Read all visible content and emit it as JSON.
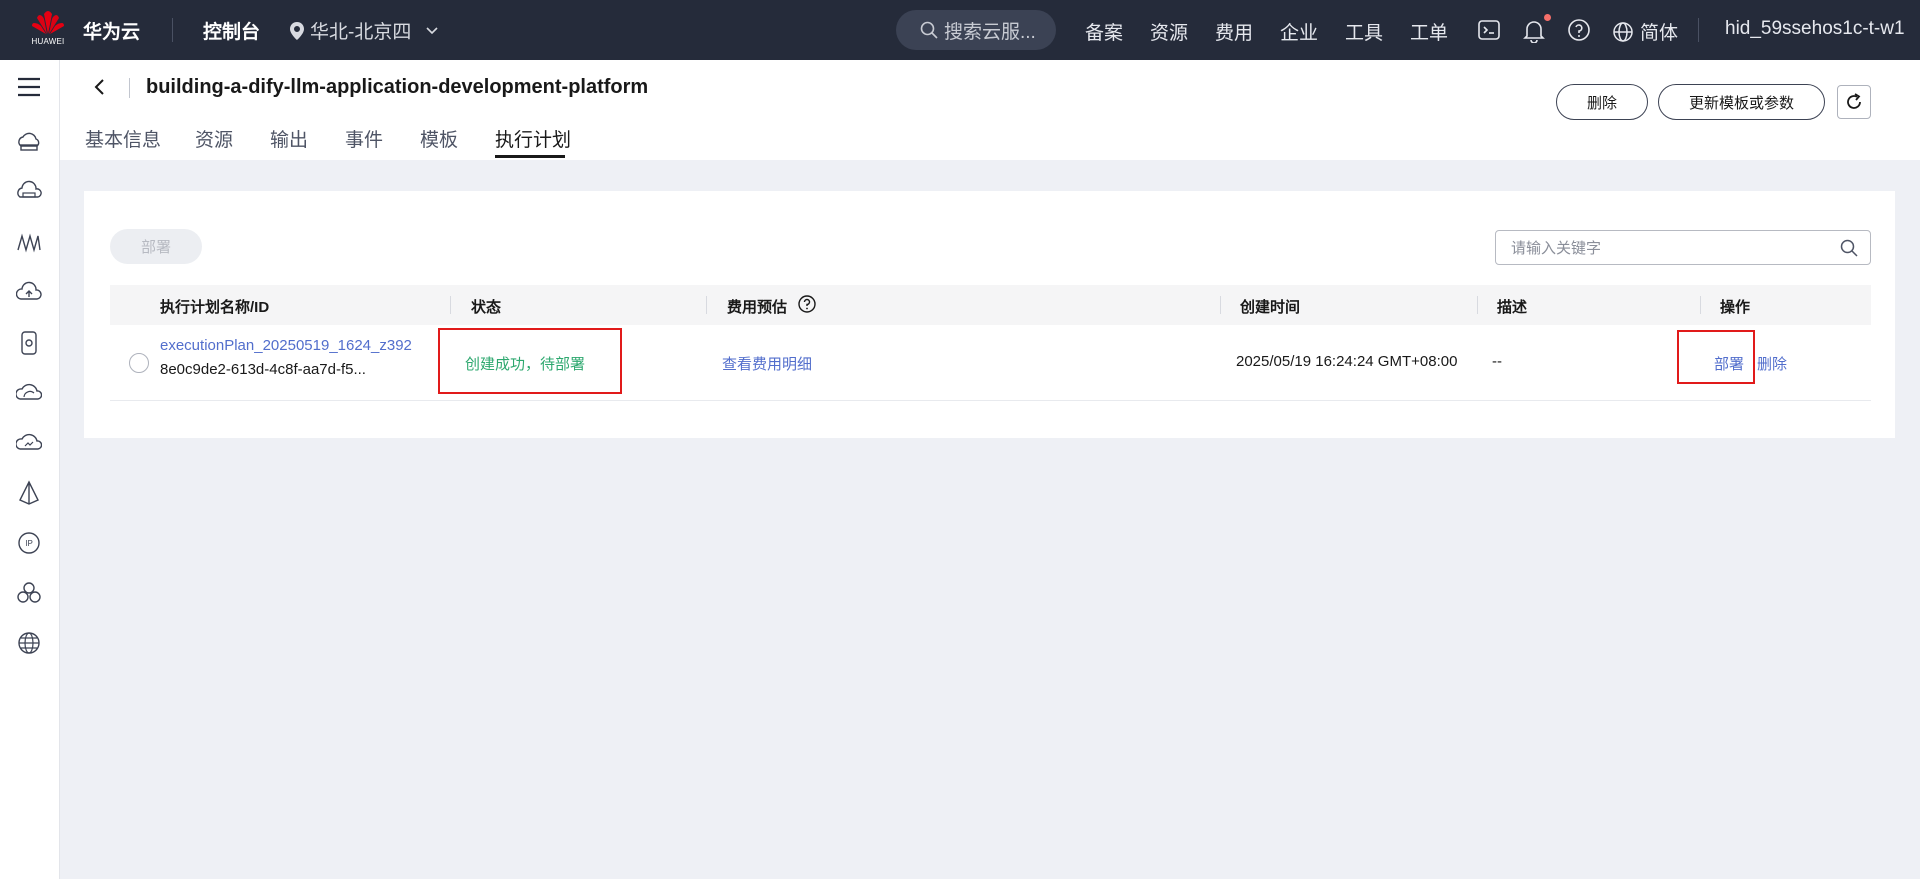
{
  "topbar": {
    "logo_text": "HUAWEI",
    "brand": "华为云",
    "console": "控制台",
    "region": "华北-北京四",
    "search_placeholder": "搜索云服...",
    "nav": [
      "备案",
      "资源",
      "费用",
      "企业",
      "工具",
      "工单"
    ],
    "language": "简体",
    "user": "hid_59ssehos1c-t-w1"
  },
  "header": {
    "title": "building-a-dify-llm-application-development-platform",
    "tabs": [
      "基本信息",
      "资源",
      "输出",
      "事件",
      "模板",
      "执行计划"
    ],
    "active_tab": "执行计划",
    "delete_label": "删除",
    "update_label": "更新模板或参数"
  },
  "toolbar": {
    "deploy_label": "部署",
    "search_placeholder": "请输入关键字"
  },
  "table": {
    "columns": [
      "执行计划名称/ID",
      "状态",
      "费用预估",
      "创建时间",
      "描述",
      "操作"
    ],
    "rows": [
      {
        "name": "executionPlan_20250519_1624_z392",
        "id": "8e0c9de2-613d-4c8f-aa7d-f5...",
        "status": "创建成功，待部署",
        "cost": "查看费用明细",
        "created": "2025/05/19 16:24:24 GMT+08:00",
        "description": "--",
        "actions": [
          "部署",
          "删除"
        ]
      }
    ]
  },
  "colors": {
    "topbar_bg": "#252b3a",
    "link": "#526ecc",
    "status_success": "#2ea86f",
    "highlight": "#e11a1a"
  },
  "icons": {
    "sidebar": [
      "menu-icon",
      "cloud-server-icon",
      "cloud-storage-icon",
      "network-icon",
      "cloud-upload-icon",
      "database-icon",
      "cloud-icon",
      "cloud-monitor-icon",
      "deploy-icon",
      "ip-icon",
      "cluster-icon",
      "web-icon"
    ]
  }
}
